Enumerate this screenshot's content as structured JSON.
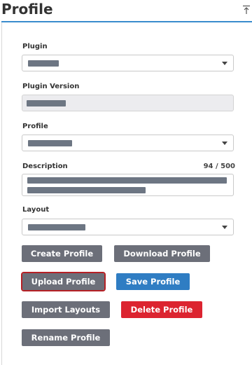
{
  "panel": {
    "title": "Profile",
    "collapse_icon": "pin-collapse-icon"
  },
  "fields": {
    "plugin": {
      "label": "Plugin",
      "value_redacted": true
    },
    "plugin_version": {
      "label": "Plugin Version",
      "value_redacted": true
    },
    "profile": {
      "label": "Profile",
      "value_redacted": true
    },
    "description": {
      "label": "Description",
      "counter": "94 / 500",
      "value_redacted": true
    },
    "layout": {
      "label": "Layout",
      "value_redacted": true
    }
  },
  "buttons": {
    "create_profile": "Create Profile",
    "download_profile": "Download Profile",
    "upload_profile": "Upload Profile",
    "save_profile": "Save Profile",
    "import_layouts": "Import Layouts",
    "delete_profile": "Delete Profile",
    "rename_profile": "Rename Profile"
  },
  "colors": {
    "accent": "#3a8ccd",
    "button_gray": "#6c6f79",
    "button_blue": "#2f7dc3",
    "button_red": "#dc2430",
    "focus_outline": "#b52025"
  }
}
